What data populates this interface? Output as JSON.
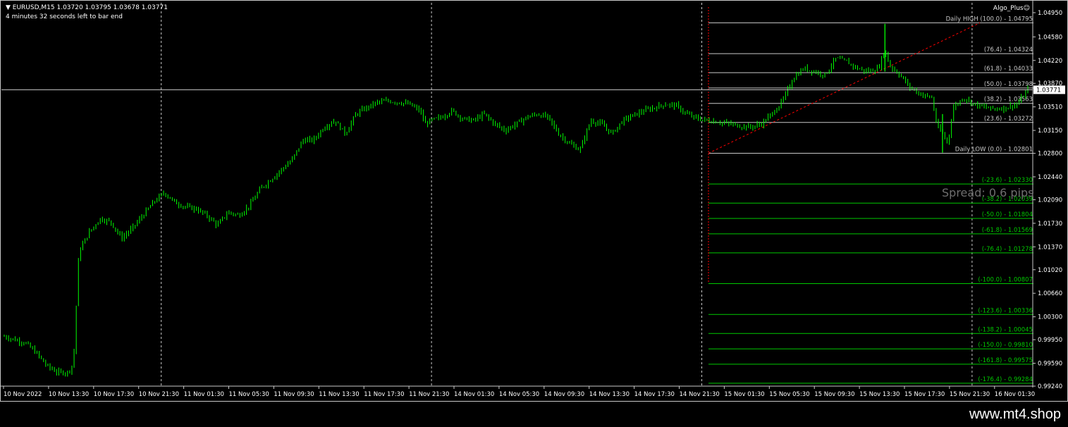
{
  "header": {
    "symbol_line": "▼ EURUSD,M15  1.03720 1.03795 1.03678 1.03771",
    "timer": "4 minutes 32 seconds left to bar end"
  },
  "expert": {
    "name": "Algo_Plus",
    "icon": "smiley-icon"
  },
  "spread_text": "Spread: 0.6 pips",
  "footer": {
    "site": "www.mt4.shop"
  },
  "current_price": "1.03771",
  "colors": {
    "background": "#000000",
    "candles": "#00ff00",
    "grid": "#c8c8c8",
    "fib_positive": "#c8c8c8",
    "fib_negative": "#00c800",
    "trend": "#ff0000"
  },
  "chart_data": {
    "type": "candlestick",
    "symbol": "EURUSD",
    "timeframe": "M15",
    "ylim": [
      0.9924,
      1.0495
    ],
    "y_ticks": [
      "1.04950",
      "1.04580",
      "1.04220",
      "1.03870",
      "1.03510",
      "1.03150",
      "1.02800",
      "1.02440",
      "1.02090",
      "1.01730",
      "1.01370",
      "1.01020",
      "1.00660",
      "1.00300",
      "0.99950",
      "0.99590",
      "0.99240"
    ],
    "x_ticks": [
      "10 Nov 2022",
      "10 Nov 13:30",
      "10 Nov 17:30",
      "10 Nov 21:30",
      "11 Nov 01:30",
      "11 Nov 05:30",
      "11 Nov 09:30",
      "11 Nov 13:30",
      "11 Nov 17:30",
      "11 Nov 21:30",
      "14 Nov 01:30",
      "14 Nov 05:30",
      "14 Nov 09:30",
      "14 Nov 13:30",
      "14 Nov 17:30",
      "14 Nov 21:30",
      "15 Nov 01:30",
      "15 Nov 05:30",
      "15 Nov 09:30",
      "15 Nov 13:30",
      "15 Nov 17:30",
      "15 Nov 21:30",
      "16 Nov 01:30"
    ],
    "session_separators": [
      "10 Nov 21:30",
      "11 Nov 21:30",
      "14 Nov 21:30",
      "15 Nov 21:30"
    ],
    "close_path": [
      [
        0,
        1.0
      ],
      [
        2,
        0.999
      ],
      [
        3,
        0.9975
      ],
      [
        4,
        0.9955
      ],
      [
        5,
        0.9945
      ],
      [
        6,
        0.9945
      ],
      [
        6.5,
        0.996
      ],
      [
        7,
        1.013
      ],
      [
        8,
        1.016
      ],
      [
        9,
        1.018
      ],
      [
        10,
        1.0175
      ],
      [
        11,
        1.015
      ],
      [
        12,
        1.0165
      ],
      [
        13,
        1.0185
      ],
      [
        14,
        1.0205
      ],
      [
        15,
        1.022
      ],
      [
        16,
        1.0205
      ],
      [
        17,
        1.0198
      ],
      [
        18,
        1.0195
      ],
      [
        19,
        1.0185
      ],
      [
        20,
        1.017
      ],
      [
        21,
        1.019
      ],
      [
        22,
        1.0185
      ],
      [
        23,
        1.02
      ],
      [
        24,
        1.0225
      ],
      [
        25,
        1.024
      ],
      [
        26,
        1.0255
      ],
      [
        27,
        1.027
      ],
      [
        28,
        1.03
      ],
      [
        29,
        1.03
      ],
      [
        30,
        1.032
      ],
      [
        31,
        1.033
      ],
      [
        32,
        1.031
      ],
      [
        33,
        1.034
      ],
      [
        34,
        1.035
      ],
      [
        35,
        1.0358
      ],
      [
        36,
        1.036
      ],
      [
        37,
        1.0358
      ],
      [
        38,
        1.0355
      ],
      [
        39,
        1.0345
      ],
      [
        39.5,
        1.0325
      ],
      [
        40,
        1.033
      ],
      [
        41,
        1.0335
      ],
      [
        42,
        1.0345
      ],
      [
        43,
        1.0333
      ],
      [
        44,
        1.033
      ],
      [
        45,
        1.034
      ],
      [
        46,
        1.0325
      ],
      [
        47,
        1.0315
      ],
      [
        48,
        1.0325
      ],
      [
        49,
        1.0335
      ],
      [
        50,
        1.034
      ],
      [
        51,
        1.0335
      ],
      [
        52,
        1.031
      ],
      [
        53,
        1.0295
      ],
      [
        54,
        1.0285
      ],
      [
        55,
        1.033
      ],
      [
        56,
        1.0325
      ],
      [
        57,
        1.031
      ],
      [
        58,
        1.033
      ],
      [
        59,
        1.0338
      ],
      [
        60,
        1.0345
      ],
      [
        61,
        1.035
      ],
      [
        62,
        1.0355
      ],
      [
        63,
        1.0353
      ],
      [
        64,
        1.034
      ],
      [
        65,
        1.0333
      ],
      [
        66,
        1.033
      ],
      [
        67,
        1.0328
      ],
      [
        68,
        1.0325
      ],
      [
        69,
        1.0322
      ],
      [
        70,
        1.032
      ],
      [
        71,
        1.0325
      ],
      [
        72,
        1.034
      ],
      [
        73,
        1.036
      ],
      [
        74,
        1.0395
      ],
      [
        75,
        1.041
      ],
      [
        76,
        1.0405
      ],
      [
        77,
        1.04
      ],
      [
        78,
        1.0425
      ],
      [
        79,
        1.042
      ],
      [
        80,
        1.041
      ],
      [
        81,
        1.0405
      ],
      [
        82,
        1.041
      ],
      [
        82.6,
        1.044
      ],
      [
        83,
        1.0415
      ],
      [
        84,
        1.04
      ],
      [
        85,
        1.038
      ],
      [
        86,
        1.037
      ],
      [
        87,
        1.0365
      ],
      [
        87.5,
        1.032
      ],
      [
        88,
        1.031
      ],
      [
        88.5,
        1.0295
      ],
      [
        89,
        1.035
      ],
      [
        90,
        1.0365
      ],
      [
        91,
        1.0355
      ],
      [
        92,
        1.035
      ],
      [
        93,
        1.0348
      ],
      [
        94,
        1.035
      ],
      [
        95,
        1.0355
      ],
      [
        96,
        1.0377
      ]
    ],
    "fibonacci": {
      "anchor_high": {
        "label": "Daily HIGH",
        "level": "(100.0)",
        "price": 1.04795,
        "text": "1.04795"
      },
      "anchor_low": {
        "label": "Daily LOW",
        "level": "(0.0)",
        "price": 1.02801,
        "text": "1.02801"
      },
      "levels": [
        {
          "level": "(76.4)",
          "price": 1.04324,
          "text": "1.04324",
          "side": "up"
        },
        {
          "level": "(61.8)",
          "price": 1.04033,
          "text": "1.04033",
          "side": "up"
        },
        {
          "level": "(50.0)",
          "price": 1.03798,
          "text": "1.03798",
          "side": "up"
        },
        {
          "level": "(38.2)",
          "price": 1.03563,
          "text": "1.03563",
          "side": "up"
        },
        {
          "level": "(23.6)",
          "price": 1.03272,
          "text": "1.03272",
          "side": "up"
        },
        {
          "level": "(-23.6)",
          "price": 1.0233,
          "text": "1.02330",
          "side": "down"
        },
        {
          "level": "(-38.2)",
          "price": 1.02039,
          "text": "1.02039",
          "side": "down"
        },
        {
          "level": "(-50.0)",
          "price": 1.01804,
          "text": "1.01804",
          "side": "down"
        },
        {
          "level": "(-61.8)",
          "price": 1.01569,
          "text": "1.01569",
          "side": "down"
        },
        {
          "level": "(-76.4)",
          "price": 1.01278,
          "text": "1.01278",
          "side": "down"
        },
        {
          "level": "(-100.0)",
          "price": 1.00807,
          "text": "1.00807",
          "side": "down"
        },
        {
          "level": "(-123.6)",
          "price": 1.00336,
          "text": "1.00336",
          "side": "down"
        },
        {
          "level": "(-138.2)",
          "price": 1.00045,
          "text": "1.00045",
          "side": "down"
        },
        {
          "level": "(-150.0)",
          "price": 0.9981,
          "text": "0.99810",
          "side": "down"
        },
        {
          "level": "(-161.8)",
          "price": 0.99575,
          "text": "0.99575",
          "side": "down"
        },
        {
          "level": "(-176.4)",
          "price": 0.99284,
          "text": "0.99284",
          "side": "down"
        }
      ]
    }
  }
}
